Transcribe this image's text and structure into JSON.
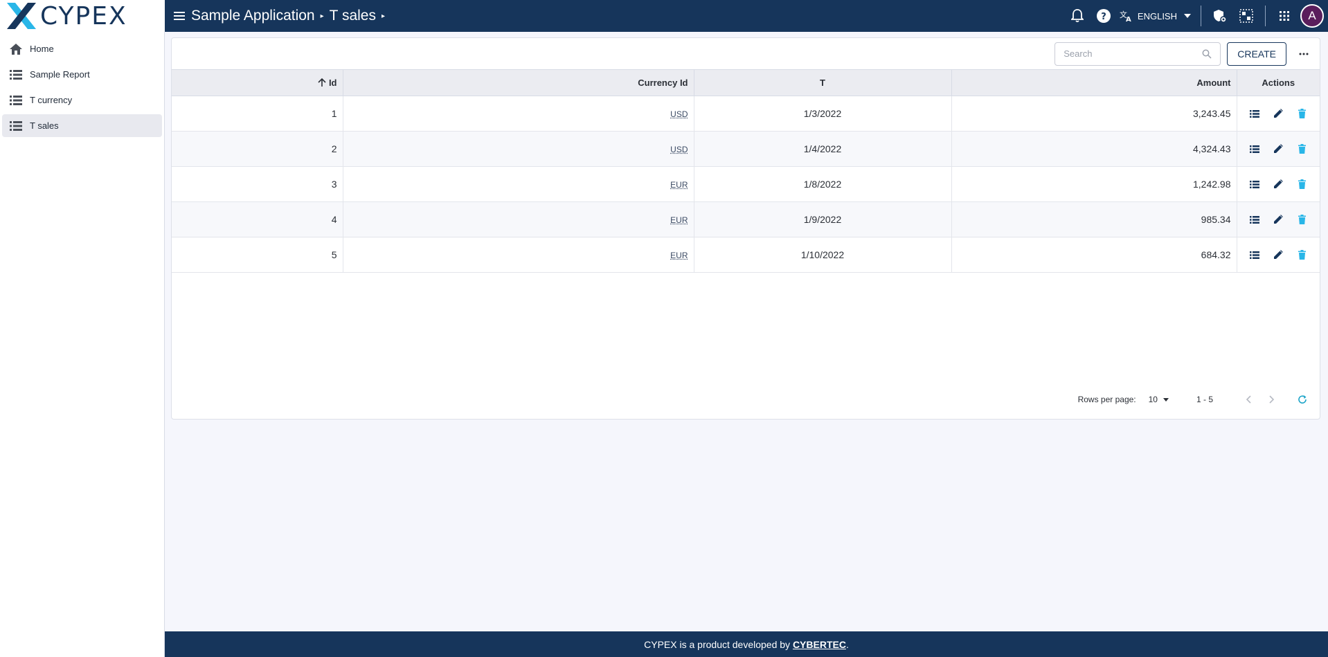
{
  "header": {
    "logo_text": "CYPEX",
    "breadcrumb": [
      "Sample Application",
      "T sales"
    ],
    "language": "ENGLISH",
    "avatar_initial": "A"
  },
  "sidebar": {
    "items": [
      {
        "label": "Home",
        "icon": "home-icon"
      },
      {
        "label": "Sample Report",
        "icon": "list-icon"
      },
      {
        "label": "T currency",
        "icon": "list-icon"
      },
      {
        "label": "T sales",
        "icon": "list-icon",
        "active": true
      }
    ]
  },
  "toolbar": {
    "search_placeholder": "Search",
    "create_label": "CREATE"
  },
  "table": {
    "columns": [
      "Id",
      "Currency Id",
      "T",
      "Amount",
      "Actions"
    ],
    "sort": {
      "column": "Id",
      "direction": "ascending"
    },
    "rows": [
      {
        "id": "1",
        "currency": "USD",
        "t": "1/3/2022",
        "amount": "3,243.45"
      },
      {
        "id": "2",
        "currency": "USD",
        "t": "1/4/2022",
        "amount": "4,324.43"
      },
      {
        "id": "3",
        "currency": "EUR",
        "t": "1/8/2022",
        "amount": "1,242.98"
      },
      {
        "id": "4",
        "currency": "EUR",
        "t": "1/9/2022",
        "amount": "985.34"
      },
      {
        "id": "5",
        "currency": "EUR",
        "t": "1/10/2022",
        "amount": "684.32"
      }
    ]
  },
  "pagination": {
    "rows_per_page_label": "Rows per page:",
    "rows_per_page": "10",
    "range": "1 - 5"
  },
  "footer": {
    "text_before": "CYPEX is a product developed by ",
    "link": "CYBERTEC",
    "text_after": "."
  },
  "colors": {
    "primary": "#16355b",
    "delete": "#29b6e8",
    "refresh": "#1aa3c8",
    "avatar": "#5a1e5c"
  }
}
